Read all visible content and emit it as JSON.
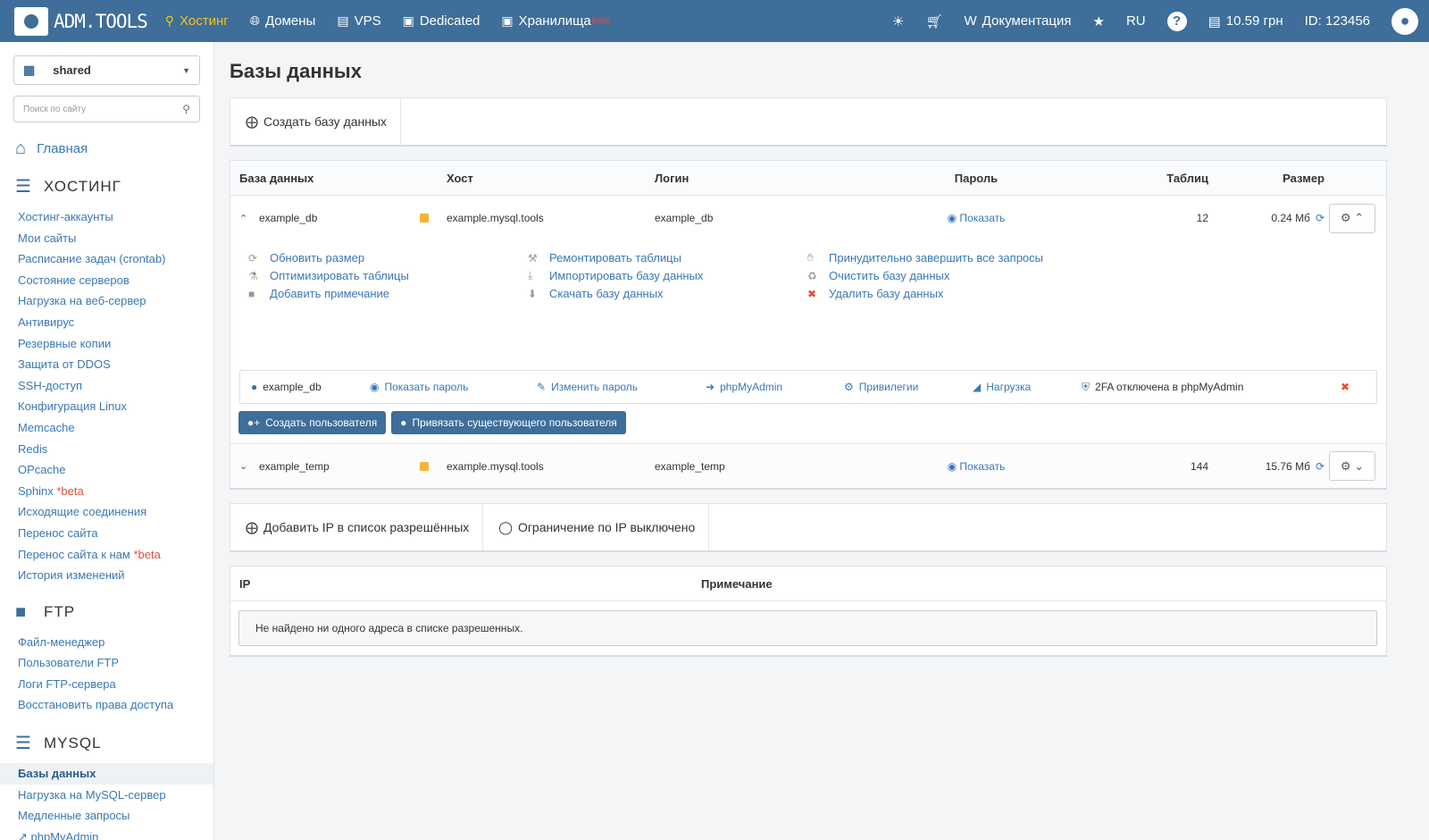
{
  "brand": {
    "logo_text": "ADM.TOOLS"
  },
  "nav": [
    {
      "label": "Хостинг",
      "icon": "sitemap-icon",
      "active": true
    },
    {
      "label": "Домены",
      "icon": "globe-icon"
    },
    {
      "label": "VPS",
      "icon": "server-icon"
    },
    {
      "label": "Dedicated",
      "icon": "hdd-icon"
    },
    {
      "label": "Хранилища",
      "icon": "storage-icon",
      "badge": "beta"
    }
  ],
  "topright": {
    "docs": "Документация",
    "lang": "RU",
    "balance": "10.59 грн",
    "account_id": "ID: 123456"
  },
  "sidebar": {
    "account": "shared",
    "search_placeholder": "Поиск по сайту",
    "home": "Главная",
    "hosting_title": "ХОСТИНГ",
    "hosting_items": [
      "Хостинг-аккаунты",
      "Мои сайты",
      "Расписание задач (crontab)",
      "Состояние серверов",
      "Нагрузка на веб-сервер",
      "Антивирус",
      "Резервные копии",
      "Защита от DDOS",
      "SSH-доступ",
      "Конфигурация Linux",
      "Memcache",
      "Redis",
      "OPcache",
      "Sphinx",
      "Исходящие соединения",
      "Перенос сайта",
      "Перенос сайта к нам",
      "История изменений"
    ],
    "beta_mark": "*beta",
    "ftp_title": "FTP",
    "ftp_items": [
      "Файл-менеджер",
      "Пользователи FTP",
      "Логи FTP-сервера",
      "Восстановить права доступа"
    ],
    "mysql_title": "MYSQL",
    "mysql_items": [
      "Базы данных",
      "Нагрузка на MySQL-сервер",
      "Медленные запросы",
      "phpMyAdmin"
    ]
  },
  "main": {
    "title": "Базы данных",
    "create_db": "Создать базу данных",
    "columns": {
      "db": "База данных",
      "host": "Хост",
      "login": "Логин",
      "password": "Пароль",
      "tables": "Таблиц",
      "size": "Размер"
    },
    "show_label": "Показать",
    "databases": [
      {
        "name": "example_db",
        "host": "example.mysql.tools",
        "login": "example_db",
        "tables": "12",
        "size": "0.24 Мб",
        "expanded": true
      },
      {
        "name": "example_temp",
        "host": "example.mysql.tools",
        "login": "example_temp",
        "tables": "144",
        "size": "15.76 Мб",
        "expanded": false
      }
    ],
    "actions": [
      {
        "label": "Обновить размер",
        "icon": "refresh-icon"
      },
      {
        "label": "Ремонтировать таблицы",
        "icon": "wrench-icon"
      },
      {
        "label": "Принудительно завершить все запросы",
        "icon": "hand-icon"
      },
      {
        "label": "Оптимизировать таблицы",
        "icon": "flask-icon"
      },
      {
        "label": "Импортировать базу данных",
        "icon": "download-icon"
      },
      {
        "label": "Очистить базу данных",
        "icon": "recycle-icon"
      },
      {
        "label": "Добавить примечание",
        "icon": "note-icon"
      },
      {
        "label": "Скачать базу данных",
        "icon": "download-circle-icon"
      },
      {
        "label": "Удалить базу данных",
        "icon": "delete-icon"
      }
    ],
    "user": {
      "name": "example_db",
      "show_pass": "Показать пароль",
      "change_pass": "Изменить пароль",
      "pma": "phpMyAdmin",
      "privileges": "Привилегии",
      "load": "Нагрузка",
      "twofa": "2FA отключена в phpMyAdmin"
    },
    "create_user": "Создать пользователя",
    "bind_user": "Привязать существующего пользователя",
    "add_ip": "Добавить IP в список разрешённых",
    "ip_limit": "Ограничение по IP выключено",
    "ip_columns": {
      "ip": "IP",
      "note": "Примечание"
    },
    "ip_empty": "Не найдено ни одного адреса в списке разрешенных."
  }
}
